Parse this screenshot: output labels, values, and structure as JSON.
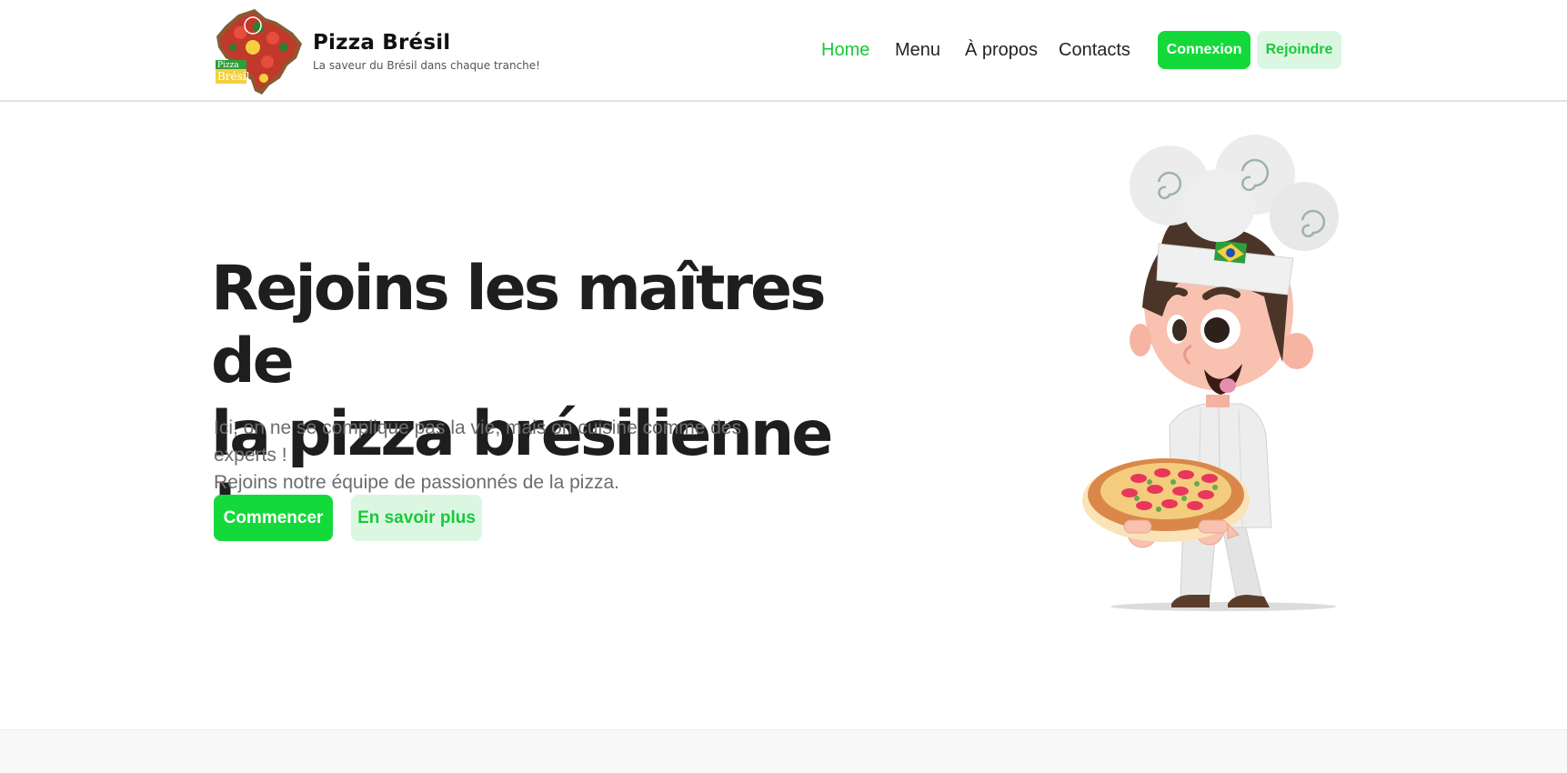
{
  "brand": {
    "name": "Pizza Brésil",
    "tagline": "La saveur du Brésil dans chaque tranche!",
    "logo_icon": "brazil-map-pizza-logo",
    "logo_text": "Pizza Brésil"
  },
  "nav": {
    "items": [
      {
        "label": "Home",
        "active": true
      },
      {
        "label": "Menu",
        "active": false
      },
      {
        "label": "À propos",
        "active": false
      },
      {
        "label": "Contacts",
        "active": false
      }
    ],
    "login_label": "Connexion",
    "join_label": "Rejoindre"
  },
  "hero": {
    "title_line1": "Rejoins les maîtres de",
    "title_line2": "la pizza brésilienne !",
    "description_line1": "Ici, on ne se complique pas la vie, mais on cuisine comme des experts !",
    "description_line2": "Rejoins notre équipe de passionnés de la pizza.",
    "primary_cta": "Commencer",
    "secondary_cta": "En savoir plus",
    "illustration": "chef-with-pizza-illustration"
  },
  "colors": {
    "accent": "#13d93a",
    "accent_light": "#dcf7e1",
    "text_dark": "#1e1e1e",
    "text_muted": "#6c6c6c"
  }
}
